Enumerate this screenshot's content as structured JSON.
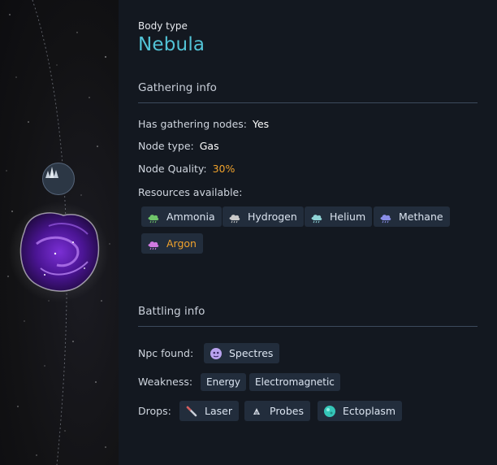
{
  "body": {
    "type_label": "Body type",
    "type_value": "Nebula"
  },
  "gathering": {
    "title": "Gathering info",
    "nodes_label": "Has gathering nodes:",
    "nodes_value": "Yes",
    "node_type_label": "Node type:",
    "node_type_value": "Gas",
    "quality_label": "Node Quality:",
    "quality_value": "30%",
    "resources_label": "Resources available:",
    "resources": [
      {
        "name": "Ammonia",
        "icon": "ammonia-cloud-icon",
        "color": "#6fc56a"
      },
      {
        "name": "Hydrogen",
        "icon": "hydrogen-cloud-icon",
        "color": "#c9c9c9"
      },
      {
        "name": "Helium",
        "icon": "helium-cloud-icon",
        "color": "#8fd3d6"
      },
      {
        "name": "Methane",
        "icon": "methane-cloud-icon",
        "color": "#8a8ee8"
      },
      {
        "name": "Argon",
        "icon": "argon-cloud-icon",
        "color": "#d07ae0"
      }
    ]
  },
  "battling": {
    "title": "Battling info",
    "npc_label": "Npc found:",
    "npc_value": "Spectres",
    "weakness_label": "Weakness:",
    "weaknesses": [
      "Energy",
      "Electromagnetic"
    ],
    "drops_label": "Drops:",
    "drops": [
      {
        "name": "Laser",
        "icon": "laser-icon"
      },
      {
        "name": "Probes",
        "icon": "probe-icon"
      },
      {
        "name": "Ectoplasm",
        "icon": "ectoplasm-icon"
      }
    ]
  },
  "colors": {
    "accent": "#52c3d6",
    "highlight": "#f0a22c",
    "chip_bg": "#222d3c",
    "panel_bg": "#131820"
  }
}
